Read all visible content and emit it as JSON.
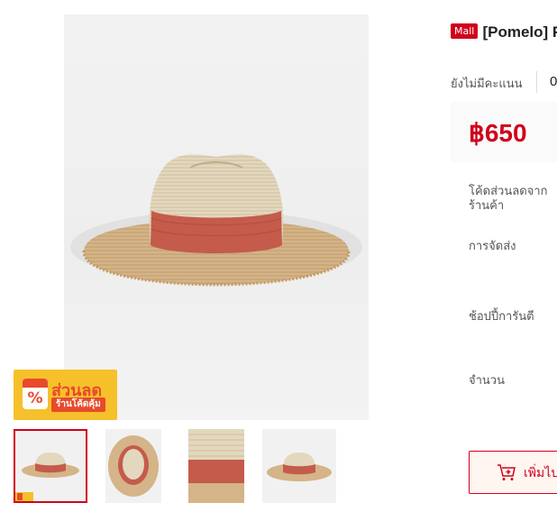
{
  "gallery": {
    "main_image_icon": "straw-fedora-hat-image",
    "promo_badge": {
      "title": "ส่วนลด",
      "subtitle": "ร้านโค้ดคุ้ม",
      "symbol": "%"
    },
    "thumbnails": [
      {
        "name": "thumbnail-1",
        "selected": true
      },
      {
        "name": "thumbnail-2",
        "selected": false
      },
      {
        "name": "thumbnail-3",
        "selected": false
      },
      {
        "name": "thumbnail-4",
        "selected": false
      }
    ]
  },
  "product": {
    "mall_badge": "Mall",
    "title": "[Pomelo] Fedora in Co",
    "no_rating_text": "ยังไม่มีคะแนน",
    "rating_count": "0",
    "price": "฿650"
  },
  "fields": {
    "shop_voucher_label": "โค้ดส่วนลดจากร้านค้า",
    "shipping_label": "การจัดส่ง",
    "guarantee_label": "ช้อปปี้การันตี",
    "quantity_label": "จำนวน"
  },
  "actions": {
    "add_to_cart_label": "เพิ่มไปยังรถเข็น"
  },
  "colors": {
    "accent": "#d0011b",
    "promo_yellow": "#f6c02b",
    "promo_red": "#e84a2b",
    "hat_straw": "#e3d7bd",
    "hat_band": "#c45b4b",
    "hat_brim": "#d4b488"
  }
}
